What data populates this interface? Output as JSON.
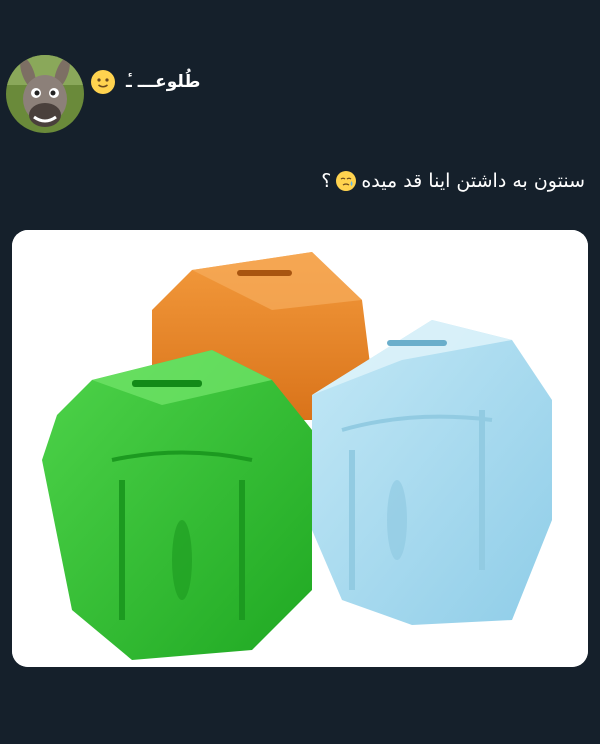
{
  "author": {
    "display_name": "طُلوعـــ ـٔ",
    "avatar_icon": "donkey-avatar-icon",
    "status_emoji": "slightly-smiling-face-emoji"
  },
  "tweet": {
    "text": "سنتون به داشتن اینا قد میده",
    "trailing_emoji": "face-holding-back-tears-emoji",
    "trailing_mark": "؟"
  },
  "media": {
    "description_icon": "piggy-banks-photo",
    "colors": {
      "orange": "#f08a23",
      "green": "#2bc42e",
      "blue": "#a9dbef"
    }
  }
}
